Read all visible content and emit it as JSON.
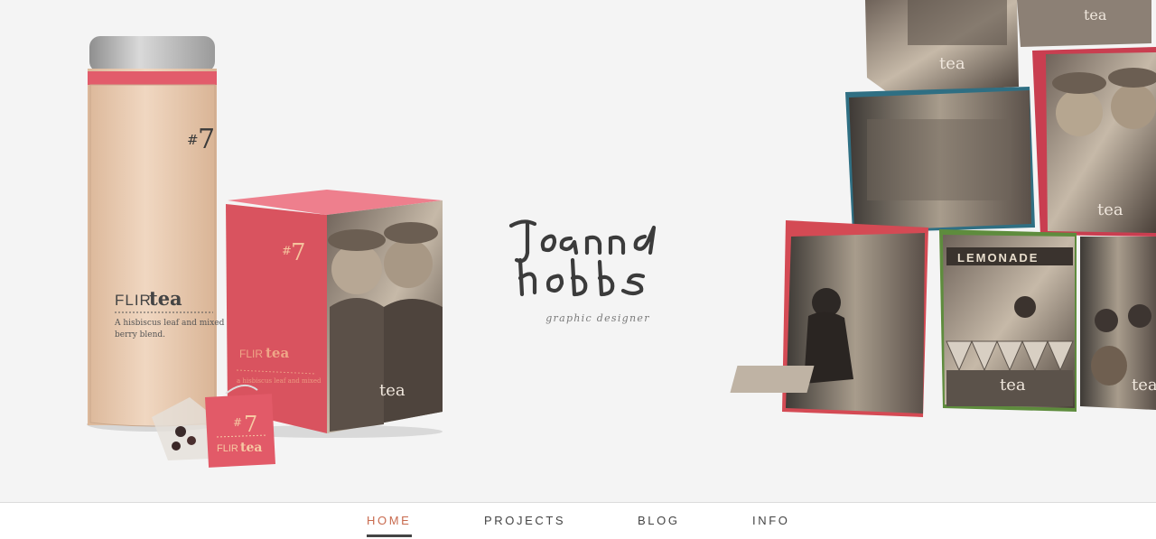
{
  "hero": {
    "tin": {
      "number": "#7",
      "brand_flir": "FLIR",
      "brand_tea": "tea",
      "description": "A hisbiscus leaf and mixed berry blend."
    },
    "box": {
      "number": "#7",
      "brand_flir": "FLIR",
      "brand_tea": "tea",
      "photo_text": "tea"
    },
    "teabag": {
      "number": "#7",
      "brand_flir": "FLIR",
      "brand_tea": "tea"
    },
    "cubes": {
      "lemonade_sign": "LEMONADE",
      "cube_label": "tea"
    }
  },
  "logo": {
    "wordmark": "Joanna Hobbs",
    "tagline": "graphic designer"
  },
  "nav": {
    "items": [
      {
        "label": "HOME",
        "active": true
      },
      {
        "label": "PROJECTS",
        "active": false
      },
      {
        "label": "BLOG",
        "active": false
      },
      {
        "label": "INFO",
        "active": false
      }
    ]
  },
  "colors": {
    "accent": "#c86a4e",
    "pink": "#d8515f",
    "kraft": "#e6c9ad",
    "ink": "#3a3a3a"
  }
}
